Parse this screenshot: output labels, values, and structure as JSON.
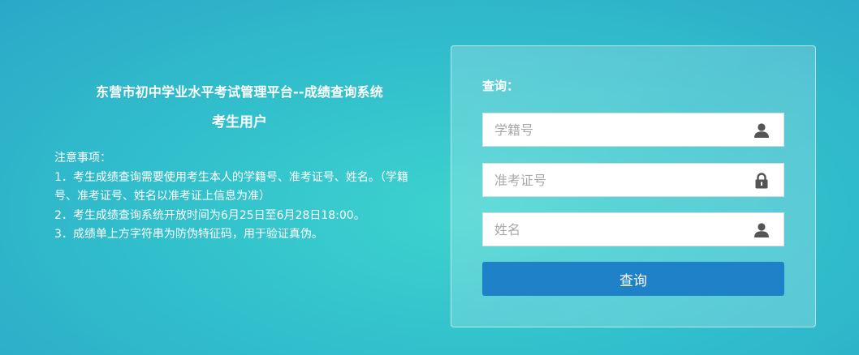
{
  "header": {
    "title": "东营市初中学业水平考试管理平台--成绩查询系统",
    "subtitle": "考生用户"
  },
  "notes": {
    "heading": "注意事项：",
    "items": [
      "1．考生成绩查询需要使用考生本人的学籍号、准考证号、姓名。（学籍号、准考证号、姓名以准考证上信息为准）",
      "2．考生成绩查询系统开放时间为6月25日至6月28日18:00。",
      "3．成绩单上方字符串为防伪特征码，用于验证真伪。"
    ]
  },
  "form": {
    "title": "查询：",
    "fields": [
      {
        "placeholder": "学籍号",
        "value": "",
        "icon": "user-icon"
      },
      {
        "placeholder": "准考证号",
        "value": "",
        "icon": "lock-icon"
      },
      {
        "placeholder": "姓名",
        "value": "",
        "icon": "user-icon"
      }
    ],
    "submit_label": "查询"
  },
  "colors": {
    "background": "#35c2cc",
    "button": "#1f82c8",
    "icon": "#555555"
  }
}
